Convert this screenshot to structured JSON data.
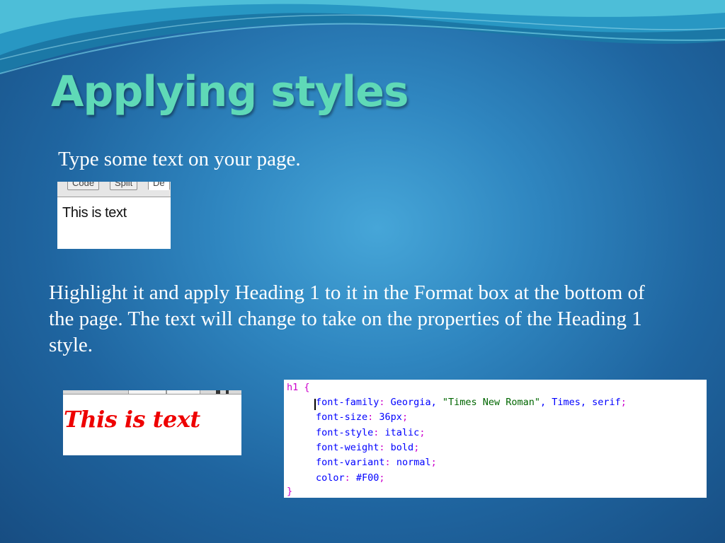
{
  "slide": {
    "title": "Applying styles",
    "line1": "Type some text on your page.",
    "paragraph": "Highlight it and apply Heading 1 to it in the Format box at the bottom of the page. The text will change to take on the properties of the Heading 1 style."
  },
  "shot1": {
    "tabs": [
      "Code",
      "Split",
      "De"
    ],
    "text": "This is text"
  },
  "shot2": {
    "text": "This is text"
  },
  "code": {
    "selector": "h1",
    "open_brace": "{",
    "close_brace": "}",
    "rules": [
      {
        "prop": "font-family",
        "value": "Georgia, \"Times New Roman\", Times, serif"
      },
      {
        "prop": "font-size",
        "value": "36px"
      },
      {
        "prop": "font-style",
        "value": "italic"
      },
      {
        "prop": "font-weight",
        "value": "bold"
      },
      {
        "prop": "font-variant",
        "value": "normal"
      },
      {
        "prop": "color",
        "value": "#F00"
      }
    ]
  },
  "colors": {
    "title": "#5fd9b7",
    "heading_text": "#ee0000",
    "background": "#2f86c0"
  }
}
